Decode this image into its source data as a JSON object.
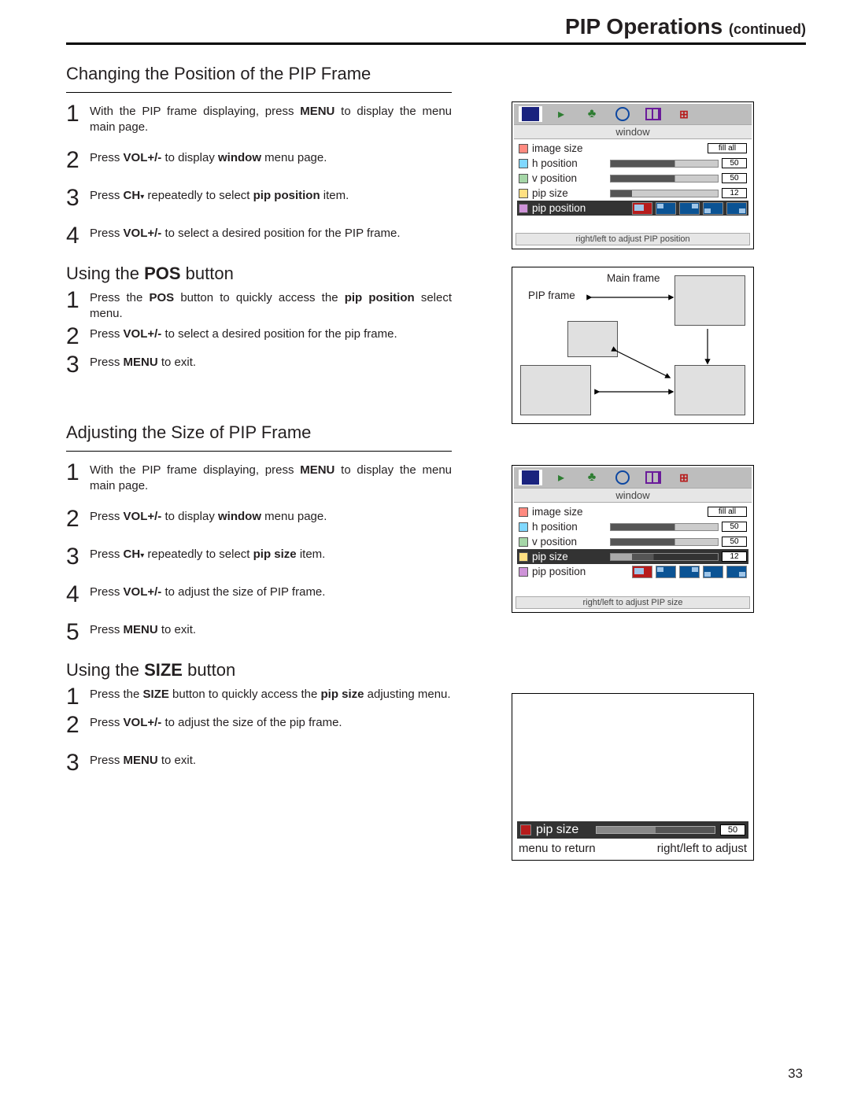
{
  "page": {
    "title_main": "PIP Operations",
    "title_cont": "(continued)",
    "number": "33"
  },
  "sec1": {
    "heading": "Changing the Position of the PIP Frame",
    "s1a": "With the PIP frame displaying, press ",
    "s1b": "MENU",
    "s1c": " to display the menu main page.",
    "s2a": "Press ",
    "s2b": "VOL+/-",
    "s2c": " to display ",
    "s2d": "window",
    "s2e": " menu page.",
    "s3a": "Press ",
    "s3b": "CH",
    "s3c": " repeatedly to select ",
    "s3d": "pip position",
    "s3e": " item.",
    "s4a": "Press ",
    "s4b": "VOL+/-",
    "s4c": " to select a desired position for the PIP frame."
  },
  "sec2": {
    "heading_pre": "Using the ",
    "heading_b": "POS",
    "heading_post": " button",
    "s1a": "Press the ",
    "s1b": "POS",
    "s1c": " button to quickly access the ",
    "s1d": "pip position",
    "s1e": " select menu.",
    "s2a": "Press ",
    "s2b": "VOL+/-",
    "s2c": " to select a desired position for the pip frame.",
    "s3a": "Press ",
    "s3b": "MENU",
    "s3c": " to exit."
  },
  "sec3": {
    "heading": "Adjusting the Size of PIP Frame",
    "s1a": "With the PIP frame displaying, press ",
    "s1b": "MENU",
    "s1c": " to display the menu main page.",
    "s2a": "Press ",
    "s2b": "VOL+/-",
    "s2c": " to display ",
    "s2d": "window",
    "s2e": " menu page.",
    "s3a": "Press ",
    "s3b": "CH",
    "s3c": " repeatedly to select ",
    "s3d": "pip size",
    "s3e": " item.",
    "s4a": "Press ",
    "s4b": "VOL+/-",
    "s4c": " to adjust the size of PIP frame.",
    "s5a": "Press ",
    "s5b": "MENU",
    "s5c": " to exit."
  },
  "sec4": {
    "heading_pre": "Using the ",
    "heading_b": "SIZE",
    "heading_post": " button",
    "s1a": "Press the ",
    "s1b": "SIZE",
    "s1c": " button to quickly access the ",
    "s1d": "pip size",
    "s1e": " adjusting menu.",
    "s2a": "Press ",
    "s2b": "VOL+/-",
    "s2c": " to adjust the size of the pip frame.",
    "s3a": "Press ",
    "s3b": "MENU",
    "s3c": " to exit."
  },
  "osd": {
    "title": "window",
    "rows": {
      "image_size": "image size",
      "h_position": "h position",
      "v_position": "v position",
      "pip_size": "pip size",
      "pip_position": "pip position"
    },
    "fill_all": "fill all",
    "v50": "50",
    "v12": "12",
    "hint_pos": "right/left to adjust PIP position",
    "hint_size": "right/left to adjust PIP size"
  },
  "posdiag": {
    "main": "Main frame",
    "pip": "PIP frame"
  },
  "sizepanel": {
    "label": "pip size",
    "value": "50",
    "left": "menu to return",
    "right": "right/left to adjust"
  },
  "nums": {
    "1": "1",
    "2": "2",
    "3": "3",
    "4": "4",
    "5": "5"
  }
}
